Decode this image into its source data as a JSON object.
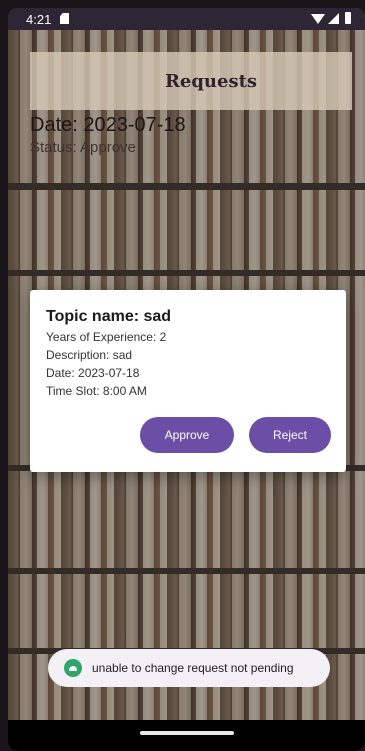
{
  "status_bar": {
    "time": "4:21",
    "icons": [
      "sd-card-icon",
      "wifi-icon",
      "signal-icon",
      "battery-icon"
    ]
  },
  "app_bar": {
    "title": "Requests"
  },
  "background_card": {
    "date": "Date: 2023-07-18",
    "status": "Status: Approve"
  },
  "dialog": {
    "topic": "Topic name: sad",
    "years": "Years of Experience: 2",
    "description": "Description: sad",
    "date": "Date: 2023-07-18",
    "time_slot": "Time Slot: 8:00 AM",
    "approve_label": "Approve",
    "reject_label": "Reject"
  },
  "toast": {
    "message": "unable to change request not pending",
    "icon": "android-icon"
  },
  "colors": {
    "accent": "#6b4ea6",
    "toast_icon": "#2fa56c"
  }
}
